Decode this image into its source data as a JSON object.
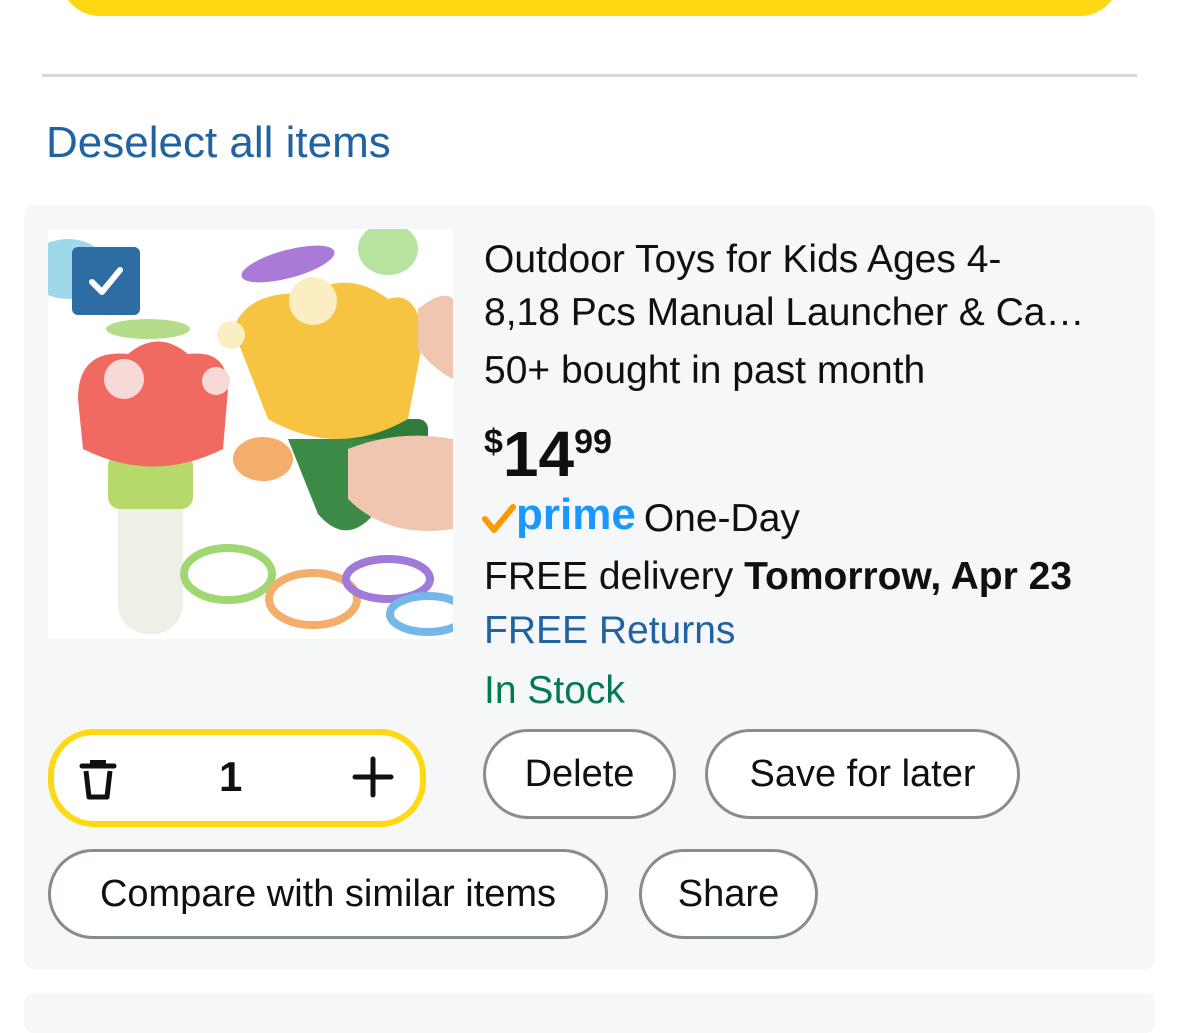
{
  "links": {
    "deselect_all": "Deselect all items"
  },
  "item": {
    "title_line1": "Outdoor Toys for Kids Ages 4-",
    "title_line2": "8,18 Pcs Manual Launcher & Ca…",
    "bought": "50+ bought in past month",
    "price": {
      "symbol": "$",
      "whole": "14",
      "fraction": "99"
    },
    "prime_logo": "prime",
    "prime_label": "One-Day",
    "delivery_prefix": "FREE delivery ",
    "delivery_date": "Tomorrow, Apr 23",
    "returns": "FREE Returns",
    "stock": "In Stock",
    "quantity": "1",
    "selected": true
  },
  "actions": {
    "delete": "Delete",
    "save_for_later": "Save for later",
    "compare": "Compare with similar items",
    "share": "Share"
  },
  "icons": {
    "trash": "trash-icon",
    "plus": "plus-icon",
    "check": "checkmark-icon",
    "prime_check": "prime-check-icon"
  },
  "colors": {
    "link": "#2162a1",
    "stock": "#007a55",
    "accent_yellow": "#ffd814",
    "checkbox": "#2e6da4",
    "prime_blue": "#1a98ff",
    "prime_orange": "#ff9900"
  }
}
